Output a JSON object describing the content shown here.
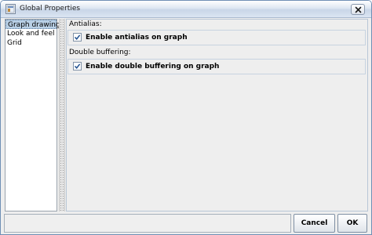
{
  "window": {
    "title": "Global Properties",
    "icons": {
      "app": "app-window-icon",
      "close": "close-icon"
    }
  },
  "nav": {
    "items": [
      {
        "label": "Graph drawing",
        "selected": true
      },
      {
        "label": "Look and feel",
        "selected": false
      },
      {
        "label": "Grid",
        "selected": false
      }
    ]
  },
  "panel": {
    "antialias": {
      "heading": "Antialias:",
      "checkbox_label": "Enable antialias on graph",
      "checked": true
    },
    "double_buffering": {
      "heading": "Double buffering:",
      "checkbox_label": "Enable double buffering on graph",
      "checked": true
    }
  },
  "footer": {
    "cancel_label": "Cancel",
    "ok_label": "OK"
  },
  "colors": {
    "selection": "#b8cfe5",
    "check": "#1f4f8f",
    "window_border": "#6f8fb5"
  }
}
